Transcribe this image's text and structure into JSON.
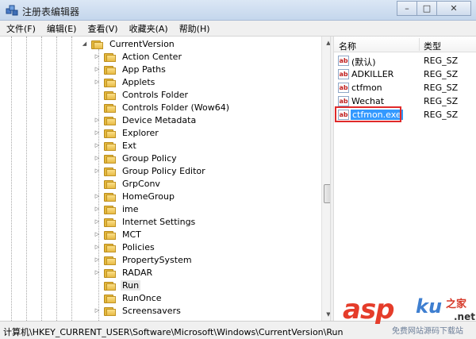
{
  "window": {
    "title": "注册表编辑器",
    "minimize": "–",
    "maximize": "□",
    "close": "✕"
  },
  "menu": [
    "文件(F)",
    "编辑(E)",
    "查看(V)",
    "收藏夹(A)",
    "帮助(H)"
  ],
  "tree": {
    "parent": "CurrentVersion",
    "children": [
      {
        "label": "Action Center",
        "expandable": true
      },
      {
        "label": "App Paths",
        "expandable": true
      },
      {
        "label": "Applets",
        "expandable": true
      },
      {
        "label": "Controls Folder",
        "expandable": false
      },
      {
        "label": "Controls Folder (Wow64)",
        "expandable": false
      },
      {
        "label": "Device Metadata",
        "expandable": true
      },
      {
        "label": "Explorer",
        "expandable": true
      },
      {
        "label": "Ext",
        "expandable": true
      },
      {
        "label": "Group Policy",
        "expandable": true
      },
      {
        "label": "Group Policy Editor",
        "expandable": true
      },
      {
        "label": "GrpConv",
        "expandable": false
      },
      {
        "label": "HomeGroup",
        "expandable": true
      },
      {
        "label": "ime",
        "expandable": true
      },
      {
        "label": "Internet Settings",
        "expandable": true
      },
      {
        "label": "MCT",
        "expandable": true
      },
      {
        "label": "Policies",
        "expandable": true
      },
      {
        "label": "PropertySystem",
        "expandable": true
      },
      {
        "label": "RADAR",
        "expandable": true
      },
      {
        "label": "Run",
        "expandable": false,
        "selected": true
      },
      {
        "label": "RunOnce",
        "expandable": false
      },
      {
        "label": "Screensavers",
        "expandable": true
      }
    ]
  },
  "values": {
    "columns": {
      "name": "名称",
      "type": "类型"
    },
    "rows": [
      {
        "name": "(默认)",
        "type": "REG_SZ"
      },
      {
        "name": "ADKILLER",
        "type": "REG_SZ"
      },
      {
        "name": "ctfmon",
        "type": "REG_SZ"
      },
      {
        "name": "Wechat",
        "type": "REG_SZ"
      },
      {
        "name": "ctfmon.exe",
        "type": "REG_SZ",
        "selected": true
      }
    ],
    "icon_text": "ab"
  },
  "status": {
    "path": "计算机\\HKEY_CURRENT_USER\\Software\\Microsoft\\Windows\\CurrentVersion\\Run"
  },
  "watermark": {
    "asp": "asp",
    "ku": "ku",
    "zhi": "之家",
    "net": ".net",
    "sub": "免费网站源码下载站"
  },
  "colors": {
    "selection": "#3399ff",
    "highlight_box": "#e02a2a",
    "folder": "#e8bb45"
  }
}
